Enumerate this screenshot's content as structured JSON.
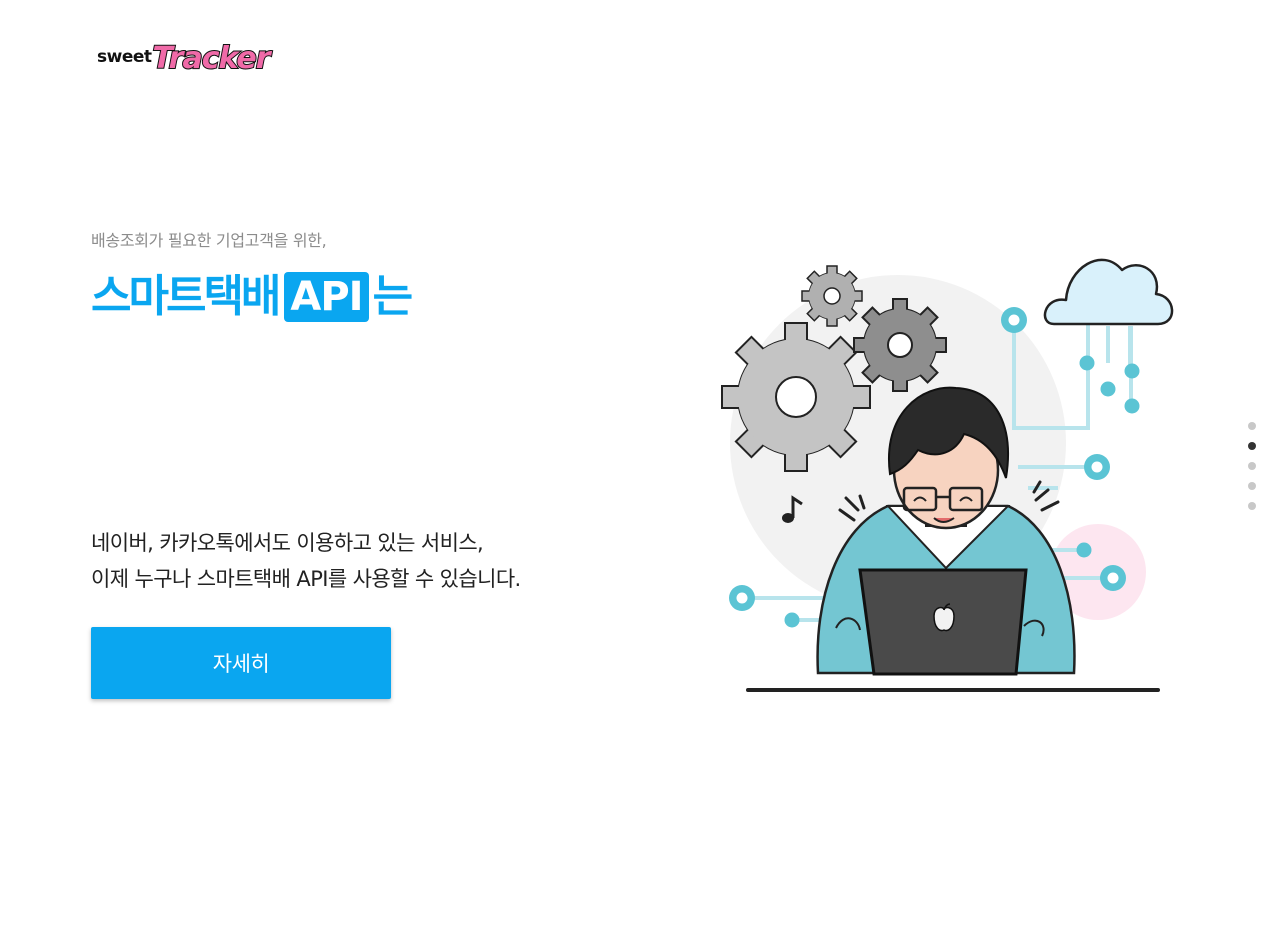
{
  "logo": {
    "prefix": "sweet",
    "name": "Tracker"
  },
  "hero": {
    "subtitle": "배송조회가 필요한 기업고객을 위한,",
    "headline_korean": "스마트택배",
    "headline_api": "API",
    "headline_tail": "는",
    "description_line1": "네이버, 카카오톡에서도 이용하고 있는 서비스,",
    "description_line2": "이제 누구나 스마트택배 API를 사용할 수 있습니다.",
    "button_label": "자세히"
  },
  "pager": {
    "total": 5,
    "active_index": 1
  },
  "colors": {
    "accent": "#0aa6f0",
    "logo_pink": "#f06aa8",
    "illustration_teal": "#5bc4d4",
    "cloud_fill": "#d9f1fb"
  },
  "illustration": {
    "icons": [
      "gear-icon",
      "cloud-icon",
      "laptop-icon",
      "music-note-icon",
      "apple-icon"
    ]
  }
}
